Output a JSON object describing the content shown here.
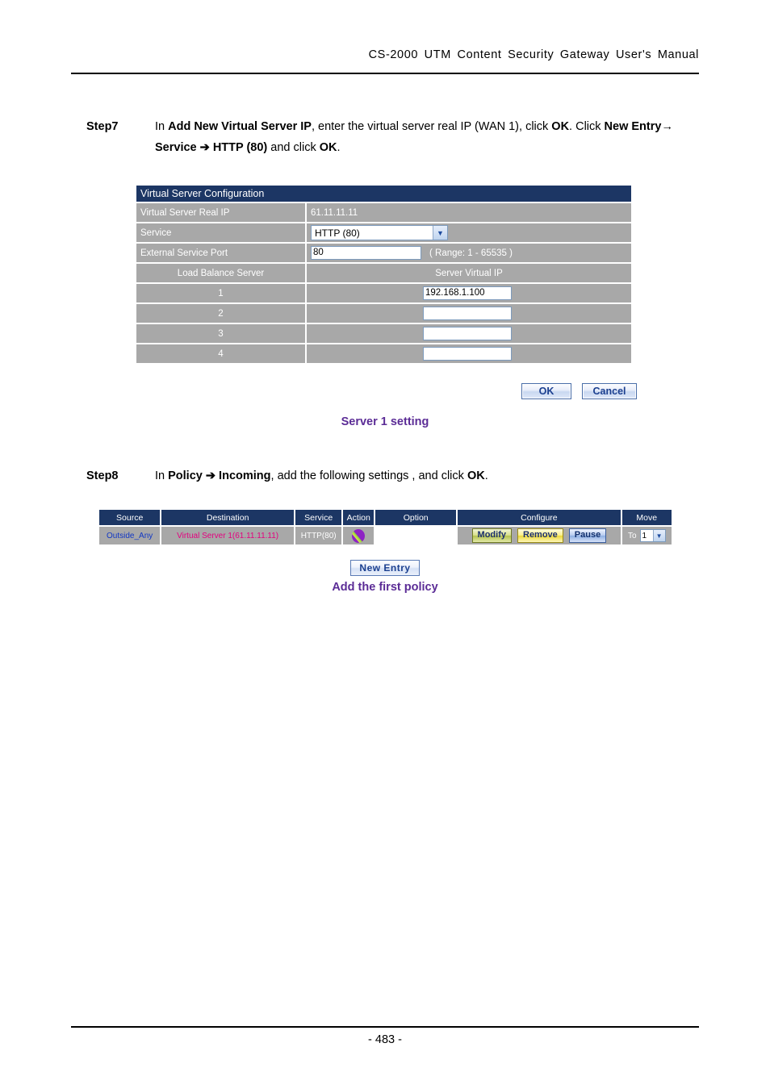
{
  "document": {
    "header_title": "CS-2000 UTM Content Security Gateway User's Manual",
    "page_number": "- 483 -"
  },
  "step7": {
    "label": "Step7",
    "text_parts": {
      "p1": "In ",
      "b1": "Add New Virtual Server IP",
      "p2": ", enter the virtual server real IP (WAN 1), click ",
      "b2": "OK",
      "p3": ". Click ",
      "b3": "New Entry",
      "arrow1": "→",
      "b4": " Service ",
      "arrow2": "➔",
      "b5": " HTTP (80)",
      "p4": " and click ",
      "b6": "OK",
      "p5": "."
    }
  },
  "virtual_server_config": {
    "title": "Virtual Server Configuration",
    "rows": [
      {
        "label": "Virtual Server Real IP",
        "value": "61.11.11.11"
      },
      {
        "label": "Service",
        "value": "HTTP (80)"
      },
      {
        "label": "External Service Port",
        "value": "80",
        "note": "( Range: 1 - 65535 )"
      }
    ],
    "balance_header": {
      "left": "Load Balance Server",
      "right": "Server Virtual IP"
    },
    "servers": [
      {
        "index": "1",
        "ip": "192.168.1.100"
      },
      {
        "index": "2",
        "ip": ""
      },
      {
        "index": "3",
        "ip": ""
      },
      {
        "index": "4",
        "ip": ""
      }
    ],
    "buttons": {
      "ok": "OK",
      "cancel": "Cancel"
    },
    "caption": "Server 1 setting",
    "colors": {
      "title_bar": "#1c3664",
      "row_bg": "#a8a8a8",
      "caption": "#5b2c96"
    }
  },
  "step8": {
    "label": "Step8",
    "text_parts": {
      "p1": "In ",
      "b1": "Policy",
      "arrow1": "➔",
      "b2": " Incoming",
      "p2": ", add the following settings , and click ",
      "b3": "OK",
      "p3": "."
    }
  },
  "policy_table": {
    "headers": [
      "Source",
      "Destination",
      "Service",
      "Action",
      "Option",
      "Configure",
      "Move"
    ],
    "row": {
      "source": "Outside_Any",
      "destination": "Virtual Server 1(61.11.11.11)",
      "service": "HTTP(80)",
      "action_icon": "policy-permit-icon",
      "option_cells": [
        "",
        "",
        "",
        "",
        "",
        ""
      ],
      "configure": {
        "modify": "Modify",
        "remove": "Remove",
        "pause": "Pause"
      },
      "move": {
        "prefix": "To",
        "value": "1"
      }
    },
    "new_entry_button": "New Entry",
    "caption": "Add the first policy",
    "colors": {
      "header_bg": "#1c3664",
      "row_bg": "#a8a8a8",
      "source_text": "#1137c4",
      "destination_text": "#e4007f",
      "service_text": "#ffffff"
    }
  }
}
